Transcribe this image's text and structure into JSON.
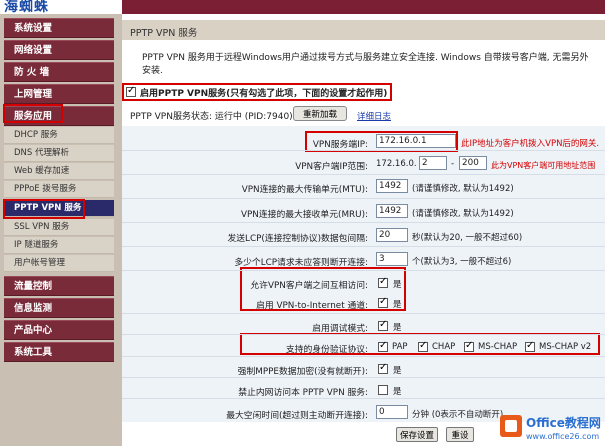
{
  "app": {
    "logo": "海蜘蛛"
  },
  "sidebar": {
    "items": [
      {
        "label": "系统设置",
        "kind": "main"
      },
      {
        "label": "网络设置",
        "kind": "main"
      },
      {
        "label": "防 火 墙",
        "kind": "main"
      },
      {
        "label": "上网管理",
        "kind": "main"
      },
      {
        "label": "服务应用",
        "kind": "main"
      },
      {
        "label": "DHCP 服务",
        "kind": "sub"
      },
      {
        "label": "DNS 代理解析",
        "kind": "sub"
      },
      {
        "label": "Web 缓存加速",
        "kind": "sub"
      },
      {
        "label": "PPPoE 拨号服务",
        "kind": "sub"
      },
      {
        "label": "PPTP VPN 服务",
        "kind": "sub",
        "active": true
      },
      {
        "label": "SSL VPN 服务",
        "kind": "sub"
      },
      {
        "label": "IP 隧道服务",
        "kind": "sub"
      },
      {
        "label": "用户帐号管理",
        "kind": "sub"
      },
      {
        "label": "流量控制",
        "kind": "main"
      },
      {
        "label": "信息监测",
        "kind": "main"
      },
      {
        "label": "产品中心",
        "kind": "main"
      },
      {
        "label": "系统工具",
        "kind": "main"
      }
    ]
  },
  "page": {
    "title": "PPTP VPN 服务",
    "description": "PPTP VPN 服务用于远程Windows用户通过拨号方式与服务建立安全连接. Windows 自带拨号客户端, 无需另外安装.",
    "enable_label": "启用PPTP VPN服务(只有勾选了此项，下面的设置才起作用)",
    "enable_checked": true,
    "status_text": "PPTP VPN服务状态: 运行中 (PID:7940)",
    "reload_button": "重新加载",
    "detail_log": "详细日志"
  },
  "form": {
    "server_ip": {
      "label": "VPN服务端IP:",
      "value": "172.16.0.1",
      "hint": "此IP地址为客户机拨入VPN后的网关."
    },
    "client_pool": {
      "label": "VPN客户端IP范围:",
      "prefix": "172.16.0.",
      "start": "2",
      "sep": "-",
      "end": "200",
      "hint": "此为VPN客户端可用地址范围"
    },
    "mtu": {
      "label": "VPN连接的最大传输单元(MTU):",
      "value": "1492",
      "hint": "(请谨慎修改, 默认为1492)"
    },
    "mru": {
      "label": "VPN连接的最大接收单元(MRU):",
      "value": "1492",
      "hint": "(请谨慎修改, 默认为1492)"
    },
    "lcp_interval": {
      "label": "发送LCP(连接控制协议)数据包间隔:",
      "value": "20",
      "hint": "秒(默认为20, 一般不超过60)"
    },
    "lcp_fail": {
      "label": "多少个LCP请求未应答则断开连接:",
      "value": "3",
      "hint": "个(默认为3, 一般不超过6)"
    },
    "client_access": {
      "label": "允许VPN客户端之间互相访问:",
      "checked": true,
      "text": "是"
    },
    "vpn_internet": {
      "label": "启用 VPN-to-Internet 通道:",
      "checked": true,
      "text": "是"
    },
    "debug_mode": {
      "label": "启用调试模式:",
      "checked": true,
      "text": "是"
    },
    "auth": {
      "label": "支持的身份验证协议:",
      "options": [
        {
          "name": "PAP",
          "checked": true
        },
        {
          "name": "CHAP",
          "checked": true
        },
        {
          "name": "MS-CHAP",
          "checked": true
        },
        {
          "name": "MS-CHAP v2",
          "checked": true
        }
      ]
    },
    "mppe": {
      "label": "强制MPPE数据加密(没有就断开):",
      "checked": true,
      "text": "是"
    },
    "deny_lan": {
      "label": "禁止内网访问本 PPTP VPN 服务:",
      "checked": false,
      "text": "是"
    },
    "idle_time": {
      "label": "最大空闲时间(超过则主动断开连接):",
      "value": "0",
      "hint": "分钟 (0表示不自动断开)"
    }
  },
  "buttons": {
    "save": "保存设置",
    "reset": "重设"
  },
  "watermark": {
    "brand": "Office教程网",
    "url": "www.office26.com"
  },
  "colors": {
    "sidebar_main": "#7a2b3a",
    "highlight": "#d40000",
    "form_bg": "#eef3f8"
  }
}
